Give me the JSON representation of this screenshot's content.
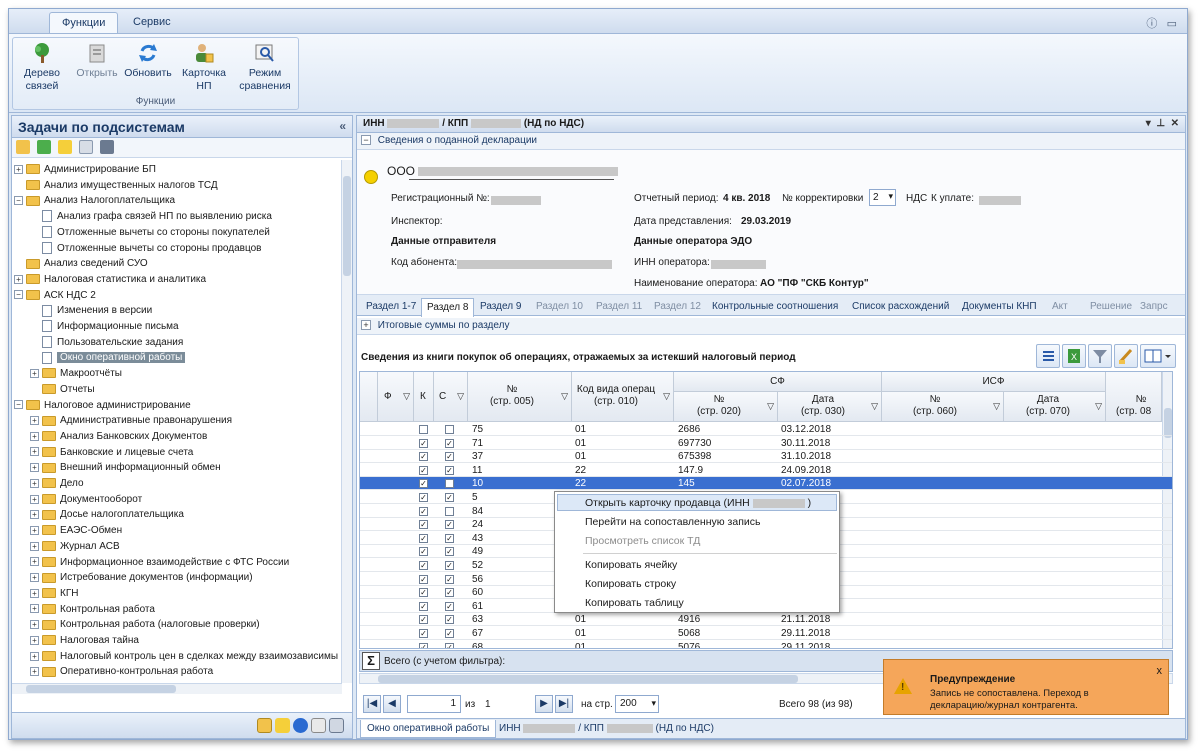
{
  "ribbon": {
    "tabs": [
      "Функции",
      "Сервис"
    ],
    "buttons": [
      {
        "line1": "Дерево",
        "line2": "связей",
        "icon": "tree-icon"
      },
      {
        "line1": "Открыть",
        "line2": "",
        "icon": "open-icon"
      },
      {
        "line1": "Обновить",
        "line2": "",
        "icon": "refresh-icon"
      },
      {
        "line1": "Карточка",
        "line2": "НП",
        "icon": "card-icon"
      },
      {
        "line1": "Режим",
        "line2": "сравнения",
        "icon": "compare-icon"
      }
    ],
    "group_label": "Функции"
  },
  "left_panel": {
    "title": "Задачи по подсистемам",
    "collapse_glyph": "«",
    "tree": [
      {
        "label": "Администрирование БП",
        "level": 0,
        "type": "folder",
        "exp": "+"
      },
      {
        "label": "Анализ имущественных налогов ТСД",
        "level": 0,
        "type": "folder",
        "exp": ""
      },
      {
        "label": "Анализ Налогоплательщика",
        "level": 0,
        "type": "folder",
        "exp": "−"
      },
      {
        "label": "Анализ графа связей НП по выявлению риска",
        "level": 1,
        "type": "doc",
        "exp": ""
      },
      {
        "label": "Отложенные вычеты со стороны покупателей",
        "level": 1,
        "type": "doc",
        "exp": ""
      },
      {
        "label": "Отложенные вычеты со стороны продавцов",
        "level": 1,
        "type": "doc",
        "exp": ""
      },
      {
        "label": "Анализ сведений СУО",
        "level": 0,
        "type": "folder",
        "exp": ""
      },
      {
        "label": "Налоговая статистика и аналитика",
        "level": 0,
        "type": "folder",
        "exp": "+"
      },
      {
        "label": "АСК НДС 2",
        "level": 0,
        "type": "folder",
        "exp": "−"
      },
      {
        "label": "Изменения в версии",
        "level": 1,
        "type": "doc",
        "exp": ""
      },
      {
        "label": "Информационные письма",
        "level": 1,
        "type": "doc",
        "exp": ""
      },
      {
        "label": "Пользовательские задания",
        "level": 1,
        "type": "doc",
        "exp": ""
      },
      {
        "label": "Окно оперативной работы",
        "level": 1,
        "type": "doc",
        "exp": "",
        "selected": true
      },
      {
        "label": "Макроотчёты",
        "level": 1,
        "type": "folder",
        "exp": "+"
      },
      {
        "label": "Отчеты",
        "level": 1,
        "type": "folder",
        "exp": ""
      },
      {
        "label": "Налоговое администрирование",
        "level": 0,
        "type": "folder",
        "exp": "−"
      },
      {
        "label": "Административные правонарушения",
        "level": 1,
        "type": "folder",
        "exp": "+"
      },
      {
        "label": "Анализ Банковских Документов",
        "level": 1,
        "type": "folder",
        "exp": "+"
      },
      {
        "label": "Банковские и лицевые счета",
        "level": 1,
        "type": "folder",
        "exp": "+"
      },
      {
        "label": "Внешний информационный обмен",
        "level": 1,
        "type": "folder",
        "exp": "+"
      },
      {
        "label": "Дело",
        "level": 1,
        "type": "folder",
        "exp": "+"
      },
      {
        "label": "Документооборот",
        "level": 1,
        "type": "folder",
        "exp": "+"
      },
      {
        "label": "Досье налогоплательщика",
        "level": 1,
        "type": "folder",
        "exp": "+"
      },
      {
        "label": "ЕАЭС-Обмен",
        "level": 1,
        "type": "folder",
        "exp": "+"
      },
      {
        "label": "Журнал АСВ",
        "level": 1,
        "type": "folder",
        "exp": "+"
      },
      {
        "label": "Информационное взаимодействие с ФТС России",
        "level": 1,
        "type": "folder",
        "exp": "+"
      },
      {
        "label": "Истребование документов (информации)",
        "level": 1,
        "type": "folder",
        "exp": "+"
      },
      {
        "label": "КГН",
        "level": 1,
        "type": "folder",
        "exp": "+"
      },
      {
        "label": "Контрольная работа",
        "level": 1,
        "type": "folder",
        "exp": "+"
      },
      {
        "label": "Контрольная работа (налоговые проверки)",
        "level": 1,
        "type": "folder",
        "exp": "+"
      },
      {
        "label": "Налоговая тайна",
        "level": 1,
        "type": "folder",
        "exp": "+"
      },
      {
        "label": "Налоговый контроль цен в сделках между взаимозависимы",
        "level": 1,
        "type": "folder",
        "exp": "+"
      },
      {
        "label": "Оперативно-контрольная работа",
        "level": 1,
        "type": "folder",
        "exp": "+"
      }
    ]
  },
  "document": {
    "title_inn": "ИНН",
    "title_kpp": "/ КПП",
    "title_suffix": "(НД по НДС)",
    "section_label": "Сведения о поданной декларации",
    "org_prefix": "ООО",
    "fields": {
      "reg_no_label": "Регистрационный №:",
      "inspector_label": "Инспектор:",
      "sender_label": "Данные отправителя",
      "subscriber_label": "Код абонента:",
      "period_label": "Отчетный период:",
      "period_value": "4 кв. 2018",
      "correction_label": "№ корректировки",
      "correction_value": "2",
      "nds_label": "НДС",
      "pay_label": "К уплате:",
      "submit_label": "Дата представления:",
      "submit_value": "29.03.2019",
      "edo_label": "Данные оператора ЭДО",
      "op_inn_label": "ИНН оператора:",
      "op_name_label": "Наименование оператора:",
      "op_name_value": "АО \"ПФ \"СКБ Контур\""
    },
    "tabs": [
      {
        "label": "Раздел 1-7",
        "state": "normal"
      },
      {
        "label": "Раздел 8",
        "state": "active"
      },
      {
        "label": "Раздел 9",
        "state": "normal"
      },
      {
        "label": "Раздел 10",
        "state": "dim"
      },
      {
        "label": "Раздел 11",
        "state": "dim"
      },
      {
        "label": "Раздел 12",
        "state": "dim"
      },
      {
        "label": "Контрольные соотношения",
        "state": "normal"
      },
      {
        "label": "Список расхождений",
        "state": "normal"
      },
      {
        "label": "Документы КНП",
        "state": "normal"
      },
      {
        "label": "Акт",
        "state": "dim"
      },
      {
        "label": "Решение",
        "state": "dim"
      },
      {
        "label": "Запрс",
        "state": "dim"
      }
    ],
    "totals_label": "Итоговые суммы по разделу",
    "grid_caption": "Сведения из книги покупок об операциях, отражаемых за истекший налоговый период"
  },
  "grid": {
    "headers": {
      "f": "Ф",
      "k": "К",
      "c": "С",
      "num": "№",
      "num_sub": "(стр. 005)",
      "kvo": "Код вида операц",
      "kvo_sub": "(стр. 010)",
      "sf": "СФ",
      "sf_num": "№",
      "sf_num_sub": "(стр. 020)",
      "sf_date": "Дата",
      "sf_date_sub": "(стр. 030)",
      "isf": "ИСФ",
      "isf_num": "№",
      "isf_num_sub": "(стр. 060)",
      "isf_date": "Дата",
      "isf_date_sub": "(стр. 070)",
      "extra_num": "№",
      "extra_sub": "(стр. 08"
    },
    "rows": [
      {
        "k": false,
        "c": false,
        "num": "75",
        "kvo": "01",
        "sfnum": "2686",
        "sfdate": "03.12.2018"
      },
      {
        "k": true,
        "c": true,
        "num": "71",
        "kvo": "01",
        "sfnum": "697730",
        "sfdate": "30.11.2018"
      },
      {
        "k": true,
        "c": true,
        "num": "37",
        "kvo": "01",
        "sfnum": "675398",
        "sfdate": "31.10.2018"
      },
      {
        "k": true,
        "c": true,
        "num": "11",
        "kvo": "22",
        "sfnum": "147.9",
        "sfdate": "24.09.2018"
      },
      {
        "k": true,
        "c": false,
        "num": "10",
        "kvo": "22",
        "sfnum": "145",
        "sfdate": "02.07.2018",
        "selected": true
      },
      {
        "k": true,
        "c": true,
        "num": "5",
        "kvo": "",
        "sfnum": "",
        "sfdate": ""
      },
      {
        "k": true,
        "c": false,
        "num": "84",
        "kvo": "",
        "sfnum": "",
        "sfdate": ""
      },
      {
        "k": true,
        "c": true,
        "num": "24",
        "kvo": "",
        "sfnum": "",
        "sfdate": ""
      },
      {
        "k": true,
        "c": true,
        "num": "43",
        "kvo": "",
        "sfnum": "",
        "sfdate": ""
      },
      {
        "k": true,
        "c": true,
        "num": "49",
        "kvo": "",
        "sfnum": "",
        "sfdate": ""
      },
      {
        "k": true,
        "c": true,
        "num": "52",
        "kvo": "",
        "sfnum": "",
        "sfdate": ""
      },
      {
        "k": true,
        "c": true,
        "num": "56",
        "kvo": "",
        "sfnum": "",
        "sfdate": ""
      },
      {
        "k": true,
        "c": true,
        "num": "60",
        "kvo": "",
        "sfnum": "",
        "sfdate": ""
      },
      {
        "k": true,
        "c": true,
        "num": "61",
        "kvo": "",
        "sfnum": "",
        "sfdate": ""
      },
      {
        "k": true,
        "c": true,
        "num": "63",
        "kvo": "01",
        "sfnum": "4916",
        "sfdate": "21.11.2018"
      },
      {
        "k": true,
        "c": true,
        "num": "67",
        "kvo": "01",
        "sfnum": "5068",
        "sfdate": "29.11.2018"
      },
      {
        "k": true,
        "c": true,
        "num": "68",
        "kvo": "01",
        "sfnum": "5076",
        "sfdate": "29.11.2018"
      }
    ],
    "sum_label": "Всего (с учетом фильтра):"
  },
  "pager": {
    "page": "1",
    "of_label": "из",
    "total_pages": "1",
    "per_page_label": "на стр.",
    "per_page": "200",
    "total_label": "Всего 98 (из 98)"
  },
  "bottom_tabs": {
    "tab1": "Окно оперативной работы",
    "tab2_inn": "ИНН",
    "tab2_kpp": "/ КПП",
    "tab2_suffix": "(НД по НДС)"
  },
  "context_menu": {
    "items": [
      {
        "label": "Открыть карточку продавца (ИНН",
        "tail": ")",
        "state": "highlight"
      },
      {
        "label": "Перейти на сопоставленную запись",
        "state": "normal"
      },
      {
        "label": "Просмотреть список ТД",
        "state": "dim"
      },
      {
        "label": "Копировать ячейку",
        "state": "normal"
      },
      {
        "label": "Копировать строку",
        "state": "normal"
      },
      {
        "label": "Копировать таблицу",
        "state": "normal"
      }
    ]
  },
  "toast": {
    "title": "Предупреждение",
    "line1": "Запись не сопоставлена. Переход в",
    "line2": "декларацию/журнал контрагента.",
    "close": "x"
  },
  "colors": {
    "selection": "#3a6fd0",
    "toast": "#f5a65a",
    "accent": "#1b3a66"
  }
}
